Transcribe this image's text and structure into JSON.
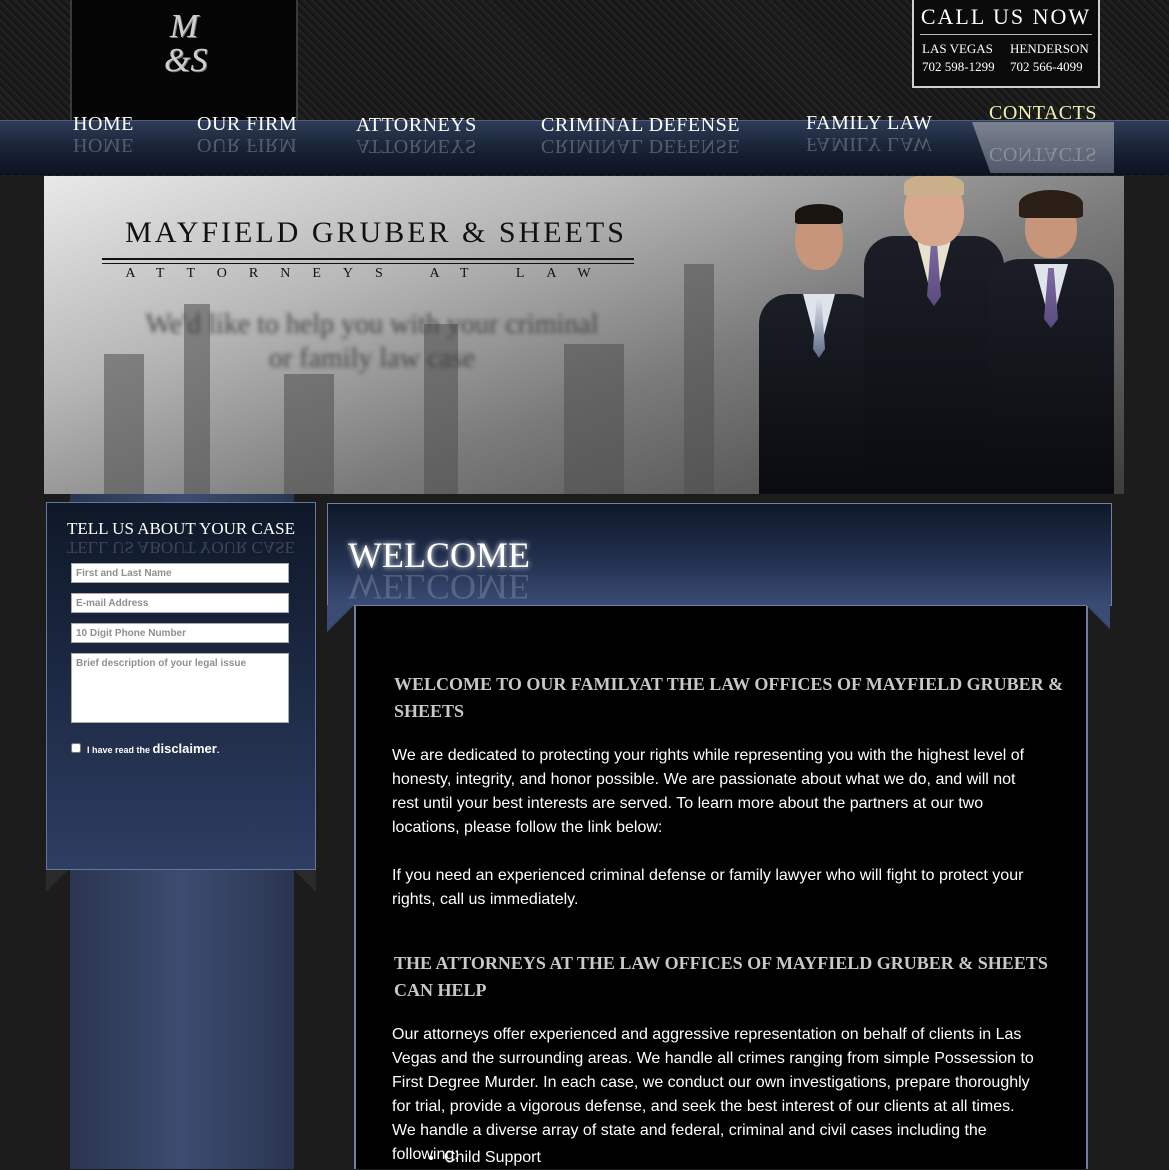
{
  "header": {
    "logo_line1": "M",
    "logo_line2": "&S",
    "call_title": "CALL US NOW",
    "locations": [
      {
        "city": "LAS VEGAS",
        "phone": "702 598-1299"
      },
      {
        "city": "HENDERSON",
        "phone": "702 566-4099"
      }
    ]
  },
  "nav": {
    "items": [
      "HOME",
      "OUR FIRM",
      "ATTORNEYS",
      "CRIMINAL DEFENSE",
      "FAMILY LAW",
      "CONTACTS"
    ],
    "active": "CONTACTS"
  },
  "hero": {
    "firm_name": "MAYFIELD GRUBER & SHEETS",
    "subtitle": "ATTORNEYS AT LAW",
    "tagline": "We'd like to help you with your criminal or family law case"
  },
  "form": {
    "title": "TELL US ABOUT YOUR CASE",
    "name_placeholder": "First and Last Name",
    "email_placeholder": "E-mail Address",
    "phone_placeholder": "10 Digit Phone Number",
    "description_placeholder": "Brief description of your legal issue",
    "disclaimer_prefix": "I have read the ",
    "disclaimer_link": "disclaimer",
    "disclaimer_suffix": "."
  },
  "main": {
    "banner_title": "WELCOME",
    "heading1": "WELCOME TO OUR FAMILYAT THE LAW OFFICES OF MAYFIELD GRUBER & SHEETS",
    "para1": "We are dedicated to protecting your rights while representing you with the highest level of honesty, integrity, and honor possible. We are passionate about what we do, and will not rest until your best interests are served. To learn more about the partners at our two locations, please follow the link below:",
    "para2": "If you need an experienced criminal defense or family lawyer who will fight to protect your rights, call us immediately.",
    "heading2": "THE ATTORNEYS AT THE LAW OFFICES OF MAYFIELD GRUBER & SHEETS CAN HELP",
    "para3": "Our attorneys offer experienced and aggressive representation on behalf of clients in Las Vegas and the surrounding areas. We handle all crimes ranging from simple Possession to First Degree Murder. In each case, we conduct our own investigations, prepare thoroughly for trial, provide a vigorous defense, and seek the best interest of our clients at all times. We handle a diverse array of state and federal, criminal and civil cases including the following:",
    "services": [
      "Child Support"
    ]
  },
  "colors": {
    "nav_blue": "#1a2538",
    "panel_blue": "#2e3e62",
    "active_nav": "#f2f0b0",
    "heading_gray": "#c8c8c8"
  }
}
